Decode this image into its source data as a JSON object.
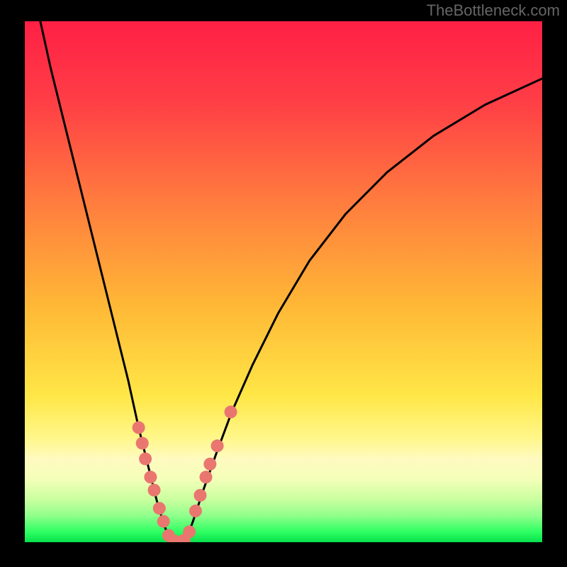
{
  "watermark": "TheBottleneck.com",
  "chart_data": {
    "type": "line",
    "title": "",
    "xlabel": "",
    "ylabel": "",
    "xlim": [
      0,
      100
    ],
    "ylim": [
      0,
      100
    ],
    "series": [
      {
        "name": "left-curve",
        "x": [
          3,
          5,
          8,
          11,
          14,
          17,
          20,
          22,
          24,
          25.5,
          27,
          28.5
        ],
        "y": [
          100,
          91,
          79,
          67,
          55,
          43,
          31,
          22,
          14,
          8,
          3,
          0
        ]
      },
      {
        "name": "right-curve",
        "x": [
          31,
          32.5,
          34.5,
          37,
          40,
          44,
          49,
          55,
          62,
          70,
          79,
          89,
          100
        ],
        "y": [
          0,
          4,
          10,
          17,
          25,
          34,
          44,
          54,
          63,
          71,
          78,
          84,
          89
        ]
      },
      {
        "name": "valley-floor",
        "x": [
          28.5,
          29.5,
          30.5,
          31
        ],
        "y": [
          0,
          -0.5,
          -0.5,
          0
        ]
      }
    ],
    "points": [
      {
        "name": "left-cluster-upper",
        "x": 22.0,
        "y": 22
      },
      {
        "name": "left-cluster-upper",
        "x": 22.7,
        "y": 19
      },
      {
        "name": "left-cluster-upper",
        "x": 23.3,
        "y": 16
      },
      {
        "name": "left-cluster-mid",
        "x": 24.3,
        "y": 12.5
      },
      {
        "name": "left-cluster-mid",
        "x": 25.0,
        "y": 10
      },
      {
        "name": "left-cluster-lower",
        "x": 26.0,
        "y": 6.5
      },
      {
        "name": "left-cluster-lower",
        "x": 26.8,
        "y": 4
      },
      {
        "name": "floor",
        "x": 27.8,
        "y": 1.3
      },
      {
        "name": "floor",
        "x": 28.8,
        "y": 0.3
      },
      {
        "name": "floor",
        "x": 29.8,
        "y": 0
      },
      {
        "name": "floor",
        "x": 30.8,
        "y": 0.4
      },
      {
        "name": "floor",
        "x": 31.8,
        "y": 2
      },
      {
        "name": "right-cluster-lower",
        "x": 33.0,
        "y": 6
      },
      {
        "name": "right-cluster-lower",
        "x": 33.9,
        "y": 9
      },
      {
        "name": "right-cluster-mid",
        "x": 35.0,
        "y": 12.5
      },
      {
        "name": "right-cluster-mid",
        "x": 35.8,
        "y": 15
      },
      {
        "name": "right-cluster-upper",
        "x": 37.2,
        "y": 18.5
      },
      {
        "name": "right-outlier",
        "x": 39.8,
        "y": 25
      }
    ],
    "point_color": "#e9766f",
    "curve_color": "#000000",
    "gradient_stops": [
      {
        "pos": 0,
        "color": "#ff2045"
      },
      {
        "pos": 35,
        "color": "#ff7d3e"
      },
      {
        "pos": 72,
        "color": "#ffe747"
      },
      {
        "pos": 100,
        "color": "#07e04c"
      }
    ]
  }
}
